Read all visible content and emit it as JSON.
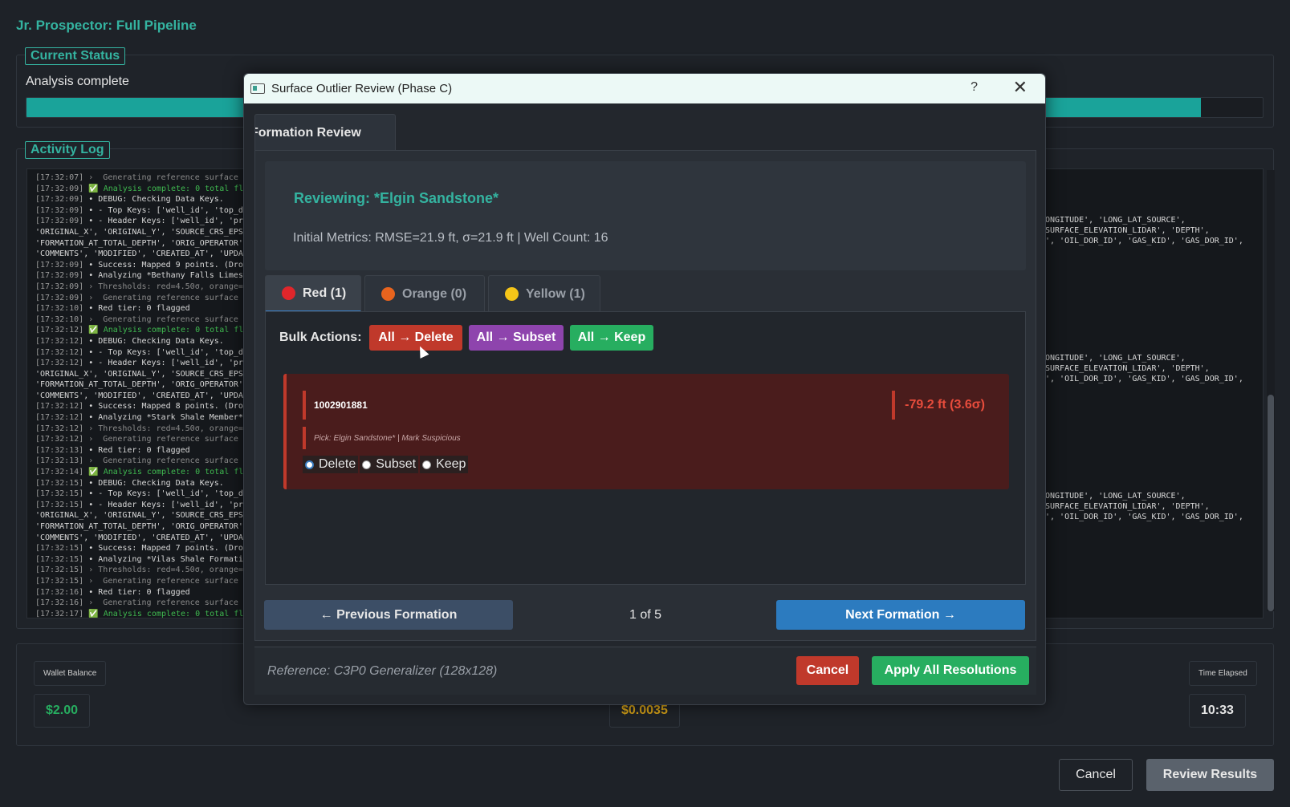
{
  "app": {
    "title": "Jr. Prospector: Full Pipeline"
  },
  "status": {
    "group_title": "Current Status",
    "text": "Analysis complete",
    "progress": 0.95
  },
  "log": {
    "group_title": "Activity Log",
    "lines": [
      {
        "ts": "[17:32:07]",
        "text": " ›  Generating reference surface (",
        "kind": "muted"
      },
      {
        "ts": "[17:32:09]",
        "text": " ✅ Analysis complete: 0 total fl",
        "kind": "ok"
      },
      {
        "ts": "[17:32:09]",
        "text": " • DEBUG: Checking Data Keys.",
        "kind": ""
      },
      {
        "ts": "[17:32:09]",
        "text": " • - Top Keys: ['well_id', 'top_d",
        "kind": ""
      },
      {
        "ts": "[17:32:09]",
        "text": " • - Header Keys: ['well_id', 'pro",
        "kind": ""
      },
      {
        "ts": "",
        "text": "'ORIGINAL_X', 'ORIGINAL_Y', 'SOURCE_CRS_EPSG",
        "kind": ""
      },
      {
        "ts": "",
        "text": "'FORMATION_AT_TOTAL_DEPTH', 'ORIG_OPERATOR'",
        "kind": ""
      },
      {
        "ts": "",
        "text": "'COMMENTS', 'MODIFIED', 'CREATED_AT', 'UPDAT",
        "kind": ""
      },
      {
        "ts": "[17:32:09]",
        "text": " • Success: Mapped 9 points. (Drop",
        "kind": ""
      },
      {
        "ts": "[17:32:09]",
        "text": " • Analyzing *Bethany Falls Limest",
        "kind": ""
      },
      {
        "ts": "[17:32:09]",
        "text": " › Thresholds: red=4.50σ, orange=",
        "kind": "muted"
      },
      {
        "ts": "[17:32:09]",
        "text": " ›  Generating reference surface (",
        "kind": "muted"
      },
      {
        "ts": "[17:32:10]",
        "text": " • Red tier: 0 flagged",
        "kind": ""
      },
      {
        "ts": "[17:32:10]",
        "text": " ›  Generating reference surface (",
        "kind": "muted"
      },
      {
        "ts": "[17:32:12]",
        "text": " ✅ Analysis complete: 0 total fl",
        "kind": "ok"
      },
      {
        "ts": "[17:32:12]",
        "text": " • DEBUG: Checking Data Keys.",
        "kind": ""
      },
      {
        "ts": "[17:32:12]",
        "text": " • - Top Keys: ['well_id', 'top_d",
        "kind": ""
      },
      {
        "ts": "[17:32:12]",
        "text": " • - Header Keys: ['well_id', 'pro",
        "kind": ""
      },
      {
        "ts": "",
        "text": "'ORIGINAL_X', 'ORIGINAL_Y', 'SOURCE_CRS_EPSG",
        "kind": ""
      },
      {
        "ts": "",
        "text": "'FORMATION_AT_TOTAL_DEPTH', 'ORIG_OPERATOR'",
        "kind": ""
      },
      {
        "ts": "",
        "text": "'COMMENTS', 'MODIFIED', 'CREATED_AT', 'UPDAT",
        "kind": ""
      },
      {
        "ts": "[17:32:12]",
        "text": " • Success: Mapped 8 points. (Drop",
        "kind": ""
      },
      {
        "ts": "[17:32:12]",
        "text": " • Analyzing *Stark Shale Member*",
        "kind": ""
      },
      {
        "ts": "[17:32:12]",
        "text": " › Thresholds: red=4.50σ, orange=",
        "kind": "muted"
      },
      {
        "ts": "[17:32:12]",
        "text": " ›  Generating reference surface (",
        "kind": "muted"
      },
      {
        "ts": "[17:32:13]",
        "text": " • Red tier: 0 flagged",
        "kind": ""
      },
      {
        "ts": "[17:32:13]",
        "text": " ›  Generating reference surface (",
        "kind": "muted"
      },
      {
        "ts": "[17:32:14]",
        "text": " ✅ Analysis complete: 0 total fl",
        "kind": "ok"
      },
      {
        "ts": "[17:32:15]",
        "text": " • DEBUG: Checking Data Keys.",
        "kind": ""
      },
      {
        "ts": "[17:32:15]",
        "text": " • - Top Keys: ['well_id', 'top_d",
        "kind": ""
      },
      {
        "ts": "[17:32:15]",
        "text": " • - Header Keys: ['well_id', 'pro",
        "kind": ""
      },
      {
        "ts": "",
        "text": "'ORIGINAL_X', 'ORIGINAL_Y', 'SOURCE_CRS_EPSG",
        "kind": ""
      },
      {
        "ts": "",
        "text": "'FORMATION_AT_TOTAL_DEPTH', 'ORIG_OPERATOR'",
        "kind": ""
      },
      {
        "ts": "",
        "text": "'COMMENTS', 'MODIFIED', 'CREATED_AT', 'UPDAT",
        "kind": ""
      },
      {
        "ts": "[17:32:15]",
        "text": " • Success: Mapped 7 points. (Drop",
        "kind": ""
      },
      {
        "ts": "[17:32:15]",
        "text": " • Analyzing *Vilas Shale Formatio",
        "kind": ""
      },
      {
        "ts": "[17:32:15]",
        "text": " › Thresholds: red=4.50σ, orange=",
        "kind": "muted"
      },
      {
        "ts": "[17:32:15]",
        "text": " ›  Generating reference surface (",
        "kind": "muted"
      },
      {
        "ts": "[17:32:16]",
        "text": " • Red tier: 0 flagged",
        "kind": ""
      },
      {
        "ts": "[17:32:16]",
        "text": " ›  Generating reference surface (",
        "kind": "muted"
      },
      {
        "ts": "[17:32:17]",
        "text": " ✅ Analysis complete: 0 total fl",
        "kind": "ok"
      }
    ],
    "right_blocks": [
      [
        "ONGITUDE', 'LONG_LAT_SOURCE',",
        "SURFACE_ELEVATION_LIDAR', 'DEPTH',",
        "', 'OIL_DOR_ID', 'GAS_KID', 'GAS_DOR_ID',"
      ],
      [
        "ONGITUDE', 'LONG_LAT_SOURCE',",
        "SURFACE_ELEVATION_LIDAR', 'DEPTH',",
        "', 'OIL_DOR_ID', 'GAS_KID', 'GAS_DOR_ID',"
      ],
      [
        "ONGITUDE', 'LONG_LAT_SOURCE',",
        "SURFACE_ELEVATION_LIDAR', 'DEPTH',",
        "', 'OIL_DOR_ID', 'GAS_KID', 'GAS_DOR_ID',"
      ]
    ]
  },
  "stats": {
    "wallet_label": "Wallet Balance",
    "wallet_value": "$2.00",
    "cost_value": "$0.0035",
    "time_label": "Time Elapsed",
    "time_value": "10:33"
  },
  "bottom": {
    "cancel_label": "Cancel",
    "review_label": "Review Results"
  },
  "dialog": {
    "title": "Surface Outlier Review (Phase C)",
    "help": "?",
    "close": "✕",
    "tab_label": "Formation Review",
    "reviewing": "Reviewing: *Elgin Sandstone*",
    "metrics": "Initial Metrics: RMSE=21.9 ft, σ=21.9 ft | Well Count: 16",
    "tiers": [
      {
        "label": "Red (1)",
        "color": "#e0262b"
      },
      {
        "label": "Orange (0)",
        "color": "#e8641e"
      },
      {
        "label": "Yellow (1)",
        "color": "#f5c518"
      }
    ],
    "bulk_label": "Bulk Actions:",
    "bulk_delete": "All → Delete",
    "bulk_subset": "All → Subset",
    "bulk_keep": "All → Keep",
    "outlier": {
      "id": "1002901881",
      "delta": "-79.2 ft (3.6σ)",
      "pick": "Pick: Elgin Sandstone* | Mark Suspicious",
      "options": [
        "Delete",
        "Subset",
        "Keep"
      ]
    },
    "prev_label": "← Previous Formation",
    "page_indicator": "1 of 5",
    "next_label": "Next Formation →",
    "reference": "Reference: C3P0 Generalizer (128x128)",
    "cancel_label": "Cancel",
    "apply_label": "Apply All Resolutions"
  },
  "colors": {
    "accent": "#34b3a0",
    "delete": "#c0392b",
    "subset": "#8e44ad",
    "keep": "#27ae60",
    "wallet": "#27ae60",
    "cost": "#d4a017"
  }
}
